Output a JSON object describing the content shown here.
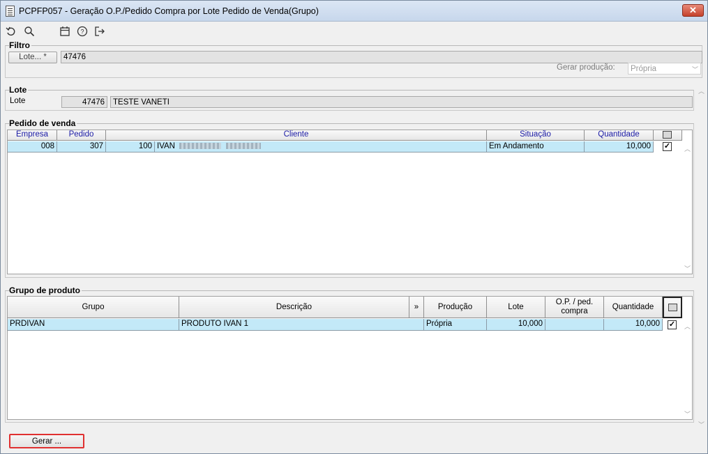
{
  "window": {
    "title": "PCPFP057 - Geração O.P./Pedido Compra por Lote Pedido de Venda(Grupo)",
    "close_label": "✕"
  },
  "toolbar": {
    "icons": [
      "undo-icon",
      "search-icon",
      "calendar-icon",
      "help-icon",
      "exit-icon"
    ]
  },
  "filtro": {
    "title": "Filtro",
    "lote_button": "Lote... *",
    "lote_value": "47476",
    "gerar_producao_label": "Gerar produção:",
    "gerar_producao_value": "Própria"
  },
  "lote": {
    "title": "Lote",
    "label": "Lote",
    "number": "47476",
    "name": "TESTE VANETI"
  },
  "pedido": {
    "title": "Pedido de venda",
    "columns": [
      "Empresa",
      "Pedido",
      "Cliente",
      "Situação",
      "Quantidade"
    ],
    "rows": [
      {
        "empresa": "008",
        "pedido": "307",
        "cliente_code": "100",
        "cliente_name": "IVAN",
        "situacao": "Em Andamento",
        "quantidade": "10,000",
        "checked": "✓"
      }
    ]
  },
  "grupo": {
    "title": "Grupo de produto",
    "columns": [
      "Grupo",
      "Descrição",
      "»",
      "Produção",
      "Lote",
      "O.P. / ped. compra",
      "Quantidade"
    ],
    "rows": [
      {
        "grupo": "PRDIVAN",
        "descricao": "PRODUTO IVAN 1",
        "producao": "Própria",
        "lote": "10,000",
        "op": "",
        "quantidade": "10,000",
        "checked": "✓"
      }
    ]
  },
  "footer": {
    "gerar_button": "Gerar ..."
  },
  "colors": {
    "selected_row": "#c3e9f8",
    "header_blue_text": "#1a1aa5",
    "highlight_border": "#e03030"
  }
}
